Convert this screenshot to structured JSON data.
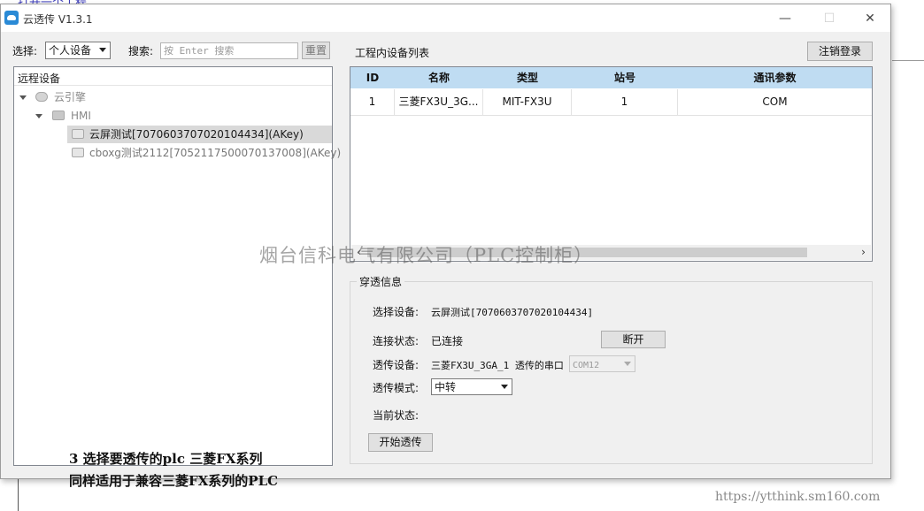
{
  "background": {
    "partial_text": "打开一个工程"
  },
  "window": {
    "title": "云透传 V1.3.1",
    "minimize_glyph": "—",
    "maximize_glyph": "☐",
    "close_glyph": "✕"
  },
  "toolbar": {
    "select_label": "选择:",
    "select_value": "个人设备",
    "search_label": "搜索:",
    "search_placeholder": "按 Enter 搜索",
    "reset_button": "重置"
  },
  "tree": {
    "header": "远程设备",
    "root": {
      "label": "云引擎",
      "icon": "cloud-icon"
    },
    "group": {
      "label": "HMI",
      "icon": "monitor-icon"
    },
    "devices": [
      {
        "label": "云屏测试[70706037070201044­34](AKey)",
        "selected": true,
        "icon": "device-icon"
      },
      {
        "label": "cboxg测试2112[7052117500070137008](AKey)",
        "selected": false,
        "icon": "device-icon"
      }
    ]
  },
  "device_list": {
    "title": "工程内设备列表",
    "logout_button": "注销登录",
    "columns": [
      "ID",
      "名称",
      "类型",
      "站号",
      "通讯参数"
    ],
    "rows": [
      [
        "1",
        "三菱FX3U_3G...",
        "MIT-FX3U",
        "1",
        "COM"
      ]
    ],
    "scroll_left": "‹",
    "scroll_right": "›"
  },
  "passthrough": {
    "group_title": "穿透信息",
    "select_device_label": "选择设备:",
    "select_device_value": "云屏测试[70706037070201044­34]",
    "connection_label": "连接状态:",
    "connection_value": "已连接",
    "disconnect_button": "断开",
    "pass_device_label": "透传设备:",
    "pass_device_value": "三菱FX3U_3GA_1 透传的串口",
    "com_port_value": "COM12",
    "mode_label": "透传模式:",
    "mode_value": "中转",
    "current_state_label": "当前状态:",
    "start_button": "开始透传"
  },
  "overlay": {
    "watermark": "烟台信科电气有限公司（PLC控制柜）",
    "caption_line1": "3 选择要透传的plc 三菱FX系列",
    "caption_line2": "同样适用于兼容三菱FX系列的PLC",
    "url": "https://ytthink.sm160.com"
  },
  "colors": {
    "grid_header": "#bfdcf2",
    "selected_node": "#d9d9d9",
    "window_bg": "#f0f0f0"
  }
}
